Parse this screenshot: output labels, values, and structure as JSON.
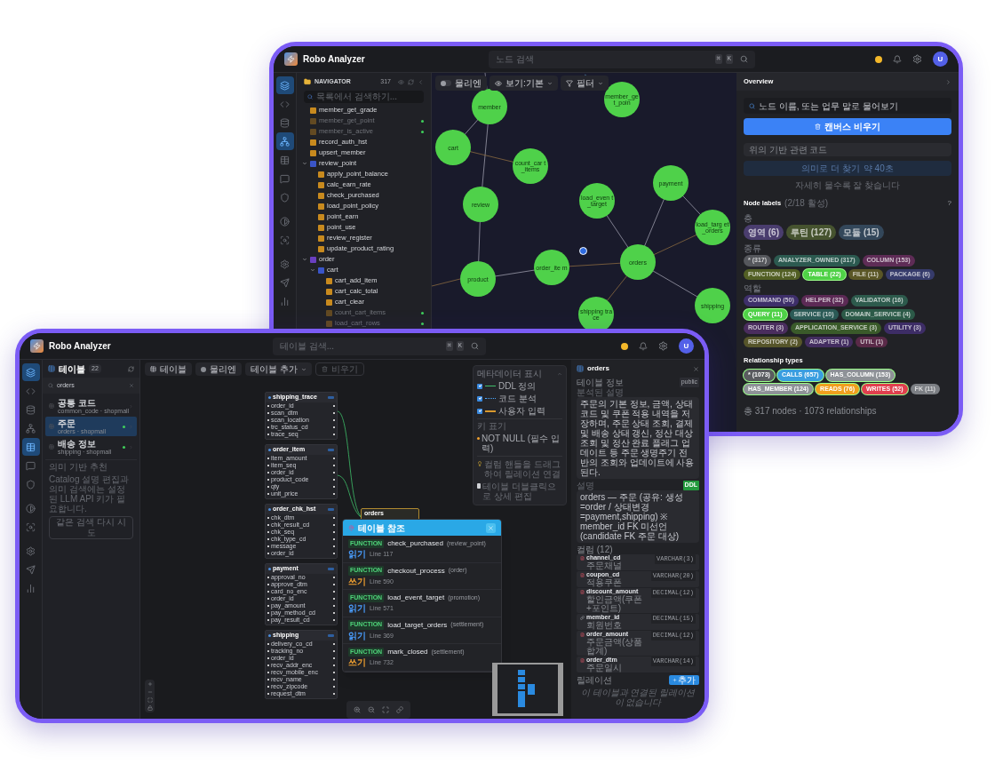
{
  "back_window": {
    "header": {
      "title": "Robo Analyzer",
      "search_placeholder": "노드 검색",
      "keys": [
        "⌘",
        "K"
      ],
      "avatar": "U"
    },
    "rail": [
      {
        "selected": true
      },
      {
        "selected": false
      },
      {
        "selected": false
      },
      {
        "selected": true
      },
      {
        "selected": false
      },
      {
        "selected": false
      },
      {
        "selected": false
      },
      {
        "selected": false
      },
      {
        "selected": false
      },
      {
        "selected": false
      },
      {
        "selected": false
      },
      {
        "selected": false
      }
    ],
    "navigator": {
      "title": "NAVIGATOR",
      "count": "317",
      "search_placeholder": "목록에서 검색하기...",
      "tree": [
        {
          "kind": "function",
          "label": "member_get_grade",
          "dimmed": false,
          "flag": false
        },
        {
          "kind": "function",
          "label": "member_get_point",
          "dimmed": true,
          "flag": true
        },
        {
          "kind": "function",
          "label": "member_is_active",
          "dimmed": true,
          "flag": true
        },
        {
          "kind": "function",
          "label": "record_auth_hst",
          "dimmed": false,
          "flag": false
        },
        {
          "kind": "function",
          "label": "upsert_member",
          "dimmed": false,
          "flag": false
        },
        {
          "kind": "module",
          "label": "review_point",
          "dimmed": false,
          "flag": false,
          "expanded": true,
          "children": [
            {
              "kind": "function",
              "label": "apply_point_balance",
              "dimmed": false,
              "flag": false
            },
            {
              "kind": "function",
              "label": "calc_earn_rate",
              "dimmed": false,
              "flag": false
            },
            {
              "kind": "function",
              "label": "check_purchased",
              "dimmed": false,
              "flag": false
            },
            {
              "kind": "function",
              "label": "load_point_policy",
              "dimmed": false,
              "flag": false
            },
            {
              "kind": "function",
              "label": "point_earn",
              "dimmed": false,
              "flag": false
            },
            {
              "kind": "function",
              "label": "point_use",
              "dimmed": false,
              "flag": false
            },
            {
              "kind": "function",
              "label": "review_register",
              "dimmed": false,
              "flag": false
            },
            {
              "kind": "function",
              "label": "update_product_rating",
              "dimmed": false,
              "flag": false
            }
          ]
        },
        {
          "kind": "package",
          "label": "order",
          "dimmed": false,
          "flag": false,
          "expanded": true,
          "children": [
            {
              "kind": "module",
              "label": "cart",
              "dimmed": false,
              "flag": false,
              "expanded": true,
              "children": [
                {
                  "kind": "function",
                  "label": "cart_add_item",
                  "dimmed": false,
                  "flag": false
                },
                {
                  "kind": "function",
                  "label": "cart_calc_total",
                  "dimmed": false,
                  "flag": false
                },
                {
                  "kind": "function",
                  "label": "cart_clear",
                  "dimmed": false,
                  "flag": false
                },
                {
                  "kind": "function",
                  "label": "count_cart_items",
                  "dimmed": true,
                  "flag": true
                },
                {
                  "kind": "function",
                  "label": "load_cart_rows",
                  "dimmed": true,
                  "flag": true
                }
              ]
            }
          ]
        }
      ]
    },
    "canvas": {
      "toolbar": [
        {
          "kind": "toggle",
          "label": "물리엔",
          "on": false
        },
        {
          "kind": "view",
          "label": "보기:기본"
        },
        {
          "kind": "filter",
          "label": "필터"
        }
      ],
      "nodes": [
        {
          "label": "member"
        },
        {
          "label": "member_get_poin"
        },
        {
          "label": "cart"
        },
        {
          "label": "count_car t_items"
        },
        {
          "label": "review"
        },
        {
          "label": "load_even t_target"
        },
        {
          "label": "payment"
        },
        {
          "label": "load_targ et_orders"
        },
        {
          "label": "order_ite m"
        },
        {
          "label": "orders"
        },
        {
          "label": "product"
        },
        {
          "label": "shipping"
        },
        {
          "label": "shipping trace"
        }
      ]
    },
    "overview": {
      "title": "Overview",
      "ask_placeholder": "노드 이름, 또는 업무 말로 물어보기",
      "clear_button": "캔버스 비우기",
      "query_value": "위의 기반 관련 코드",
      "search_button": {
        "label": "의미로 더 찾기",
        "hint": "약 40초",
        "disabled": true
      },
      "tip": "자세히 물수록 잘 찾습니다",
      "node_labels": {
        "title": "Node labels",
        "active": "(2/18 활성)",
        "help": "?",
        "groups": [
          {
            "label": "층",
            "chips": [
              {
                "label": "영역 (6)",
                "color": "#4a3d6e",
                "selected": false
              },
              {
                "label": "루틴 (127)",
                "color": "#46532f",
                "selected": false
              },
              {
                "label": "모듈 (15)",
                "color": "#33475a",
                "selected": false
              }
            ]
          },
          {
            "label": "종류",
            "chips": [
              {
                "label": "* (317)",
                "color": "#55575c",
                "selected": false
              },
              {
                "label": "ANALYZER_OWNED (317)",
                "color": "#2c5a50",
                "selected": false
              },
              {
                "label": "COLUMN (153)",
                "color": "#5e2c56",
                "selected": false
              },
              {
                "label": "FUNCTION (124)",
                "color": "#525f24",
                "selected": false
              },
              {
                "label": "TABLE (22)",
                "color": "#4fd147",
                "selected": true
              },
              {
                "label": "FILE (11)",
                "color": "#5a5626",
                "selected": false
              },
              {
                "label": "PACKAGE (6)",
                "color": "#363b6b",
                "selected": false
              }
            ]
          },
          {
            "label": "역할",
            "chips": [
              {
                "label": "COMMAND (50)",
                "color": "#3e2f6a",
                "selected": false
              },
              {
                "label": "HELPER (32)",
                "color": "#5c2a55",
                "selected": false
              },
              {
                "label": "VALIDATOR (16)",
                "color": "#2d5a4c",
                "selected": false
              },
              {
                "label": "QUERY (11)",
                "color": "#4fd147",
                "selected": true
              },
              {
                "label": "SERVICE (10)",
                "color": "#2b5a56",
                "selected": false
              },
              {
                "label": "DOMAIN_SERVICE (4)",
                "color": "#2c5a48",
                "selected": false
              },
              {
                "label": "ROUTER (3)",
                "color": "#4a2d5e",
                "selected": false
              },
              {
                "label": "APPLICATION_SERVICE (3)",
                "color": "#3a5a2a",
                "selected": false
              },
              {
                "label": "UTILITY (3)",
                "color": "#3d2d66",
                "selected": false
              },
              {
                "label": "REPOSITORY (2)",
                "color": "#56552a",
                "selected": false
              },
              {
                "label": "ADAPTER (1)",
                "color": "#432d60",
                "selected": false
              },
              {
                "label": "UTIL (1)",
                "color": "#5a2a48",
                "selected": false
              }
            ]
          }
        ]
      },
      "relationship_types": {
        "title": "Relationship types",
        "chips": [
          {
            "label": "* (1073)",
            "color": "#5a5c60",
            "selected": true
          },
          {
            "label": "CALLS (657)",
            "color": "#3a9ee0",
            "selected": true
          },
          {
            "label": "HAS_COLUMN (153)",
            "color": "#8e9297",
            "selected": true
          },
          {
            "label": "HAS_MEMBER (124)",
            "color": "#8e9297",
            "selected": true
          },
          {
            "label": "READS (76)",
            "color": "#f0a01e",
            "selected": true
          },
          {
            "label": "WRITES (52)",
            "color": "#e0404e",
            "selected": true
          },
          {
            "label": "FK (11)",
            "color": "#7c7f84",
            "selected": false
          }
        ]
      },
      "footer": "총 317 nodes · 1073 relationships"
    }
  },
  "front_window": {
    "header": {
      "title": "Robo Analyzer",
      "search_placeholder": "테이블 검색...",
      "keys": [
        "⌘",
        "K"
      ],
      "avatar": "U"
    },
    "rail": [
      {
        "selected": true
      },
      {
        "selected": false
      },
      {
        "selected": false
      },
      {
        "selected": false
      },
      {
        "selected": true
      },
      {
        "selected": false
      },
      {
        "selected": false
      },
      {
        "selected": false
      },
      {
        "selected": false
      },
      {
        "selected": false
      },
      {
        "selected": false
      },
      {
        "selected": false
      }
    ],
    "tables_panel": {
      "title": "테이블",
      "count": "22",
      "search_value": "orders",
      "items": [
        {
          "name": "공통 코드",
          "sub": "common_code · shopmall",
          "selected": false,
          "indexed": false
        },
        {
          "name": "주문",
          "sub": "orders · shopmall",
          "selected": true,
          "indexed": true
        },
        {
          "name": "배송 정보",
          "sub": "shipping · shopmall",
          "selected": false,
          "indexed": true
        }
      ],
      "recommend_title": "의미 기반 추천",
      "recommend_text": "Catalog 설명 편집과 의미 검색에는 설정된 LLM API 키가 필요합니다.",
      "retry_button": "같은 검색 다시 시도"
    },
    "canvas": {
      "toolbar": [
        {
          "kind": "table",
          "label": "테이블",
          "disabled": false
        },
        {
          "kind": "toggle",
          "label": "물리엔",
          "disabled": false
        },
        {
          "kind": "add",
          "label": "테이블 추가",
          "disabled": false
        },
        {
          "kind": "clear",
          "label": "비우기",
          "disabled": true
        }
      ],
      "tables": [
        {
          "name": "shipping_trace",
          "columns": [
            "order_id",
            "scan_dtm",
            "scan_location",
            "trc_status_cd",
            "trace_seq"
          ]
        },
        {
          "name": "order_item",
          "columns": [
            "item_amount",
            "item_seq",
            "order_id",
            "product_code",
            "qty",
            "unit_price"
          ]
        },
        {
          "name": "order_chk_hst",
          "columns": [
            "chk_dtm",
            "chk_result_cd",
            "chk_seq",
            "chk_type_cd",
            "message",
            "order_id"
          ]
        },
        {
          "name": "payment",
          "columns": [
            "approval_no",
            "approve_dtm",
            "card_no_enc",
            "order_id",
            "pay_amount",
            "pay_method_cd",
            "pay_result_cd"
          ]
        },
        {
          "name": "shipping",
          "columns": [
            "delivery_co_cd",
            "tracking_no",
            "order_id",
            "recv_addr_enc",
            "recv_mobile_enc",
            "recv_name",
            "recv_zipcode",
            "request_dtm"
          ]
        }
      ],
      "focus_table": "orders",
      "legend": {
        "title": "메타데이터 표시",
        "items": [
          {
            "kind": "solid",
            "label": "DDL 정의",
            "checked": true
          },
          {
            "kind": "dotted",
            "label": "코드 분석",
            "checked": true
          },
          {
            "kind": "thick",
            "label": "사용자 입력",
            "checked": true
          }
        ],
        "key_title": "키 표기",
        "not_null": "NOT NULL (필수 입력)",
        "tips": [
          "컬럼 핸들을 드래그하여 릴레이션 연결",
          "테이블 더블클릭으로 상세 편집"
        ]
      },
      "references": {
        "title": "테이블 참조",
        "items": [
          {
            "badge": "FUNCTION",
            "name": "check_purchased",
            "module": "(review_point)",
            "access": "읽기",
            "kind": "read",
            "line": "Line 117"
          },
          {
            "badge": "FUNCTION",
            "name": "checkout_process",
            "module": "(order)",
            "access": "쓰기",
            "kind": "write",
            "line": "Line 590"
          },
          {
            "badge": "FUNCTION",
            "name": "load_event_target",
            "module": "(promotion)",
            "access": "읽기",
            "kind": "read",
            "line": "Line 571"
          },
          {
            "badge": "FUNCTION",
            "name": "load_target_orders",
            "module": "(settlement)",
            "access": "읽기",
            "kind": "read",
            "line": "Line 369"
          },
          {
            "badge": "FUNCTION",
            "name": "mark_closed",
            "module": "(settlement)",
            "access": "쓰기",
            "kind": "write",
            "line": "Line 732"
          }
        ]
      }
    },
    "detail": {
      "title": "orders",
      "info_label": "테이블 정보",
      "schema": "public",
      "analysis_label": "분석된 설명",
      "analysis": "주문의 기본 정보, 금액, 상태 코드 및 쿠폰 적용 내역을 저장하며, 주문 상태 조회, 결제 및 배송 상태 갱신, 정산 대상 조회 및 정산 완료 플래그 업데이트 등 주문 생명주기 전반의 조회와 업데이트에 사용된다.",
      "desc_label": "설명",
      "desc_badge": "DDL",
      "description": "orders — 주문 (공유: 생성=order / 상태변경=payment,shipping) ※ member_id FK 미선언 (candidate FK 주문 대상)",
      "columns_label": "컬럼 (12)",
      "columns": [
        {
          "kind": "column",
          "name": "channel_cd",
          "comment": "주문채널",
          "type": "VARCHAR(3)"
        },
        {
          "kind": "column",
          "name": "coupon_cd",
          "comment": "적용쿠폰",
          "type": "VARCHAR(20)"
        },
        {
          "kind": "column",
          "name": "discount_amount",
          "comment": "할인금액(쿠폰+포인트)",
          "type": "DECIMAL(12)"
        },
        {
          "kind": "fk",
          "name": "member_id",
          "comment": "회원번호",
          "type": "DECIMAL(15)"
        },
        {
          "kind": "column",
          "name": "order_amount",
          "comment": "주문금액(상품합계)",
          "type": "DECIMAL(12)"
        },
        {
          "kind": "column",
          "name": "order_dtm",
          "comment": "주문일시",
          "type": "VARCHAR(14)"
        }
      ],
      "relations_label": "릴레이션",
      "add_button": "추가",
      "relations_empty": "이 테이블과 연결된 릴레이션이 없습니다"
    }
  }
}
